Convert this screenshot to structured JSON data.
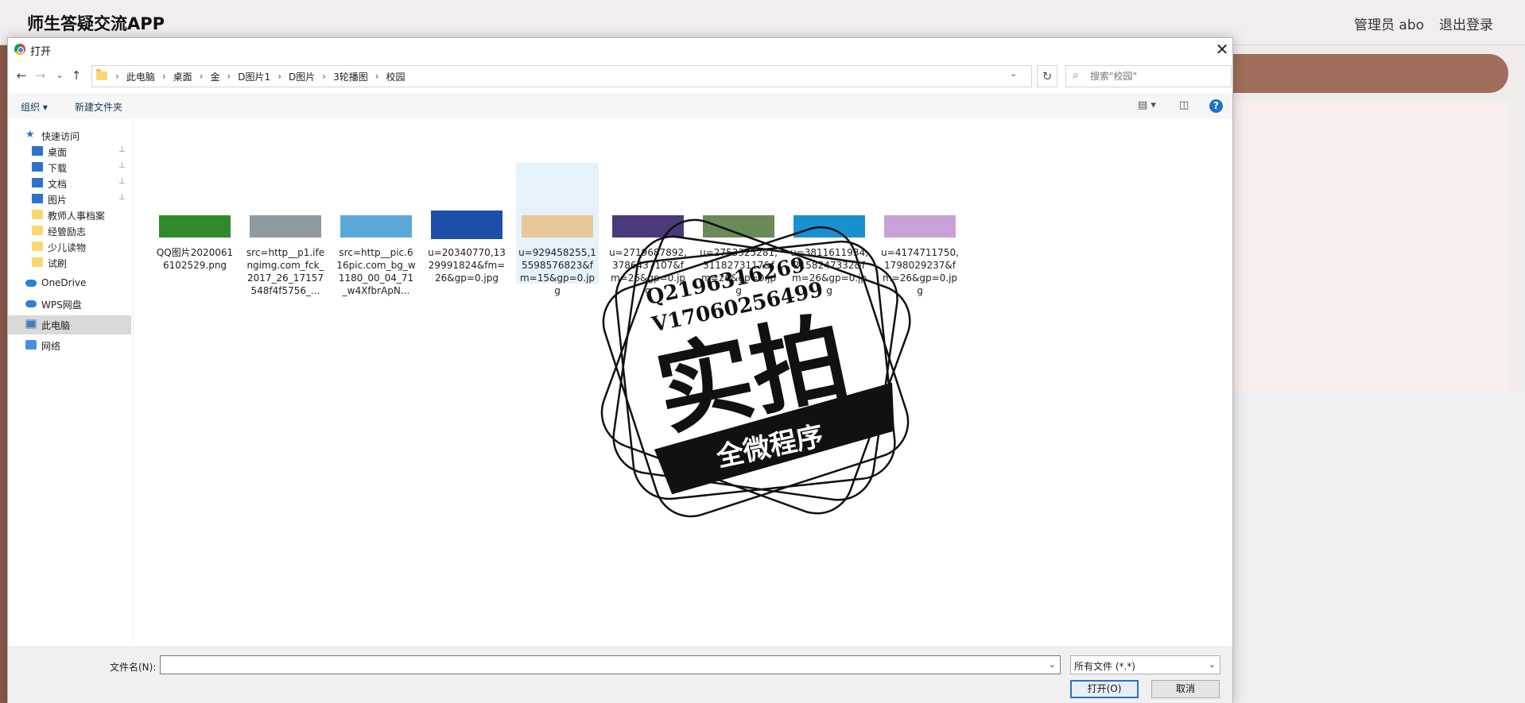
{
  "app": {
    "title": "师生答疑交流APP",
    "user": "管理员 abo",
    "logout": "退出登录"
  },
  "dialog": {
    "title": "打开",
    "close": "✕",
    "nav": {
      "back": "←",
      "forward": "→",
      "recent": "⌄",
      "up": "↑",
      "refresh": "↻",
      "dropdown": "⌄"
    },
    "breadcrumbs": [
      "此电脑",
      "桌面",
      "金",
      "D图片1",
      "D图片",
      "3轮播图",
      "校园"
    ],
    "search_placeholder": "搜索\"校园\"",
    "toolbar": {
      "organize": "组织 ▾",
      "new_folder": "新建文件夹",
      "view_icon": "▤ ▾",
      "pane_icon": "◫",
      "help": "?"
    },
    "sidebar": [
      {
        "label": "快速访问",
        "icon": "star-icon",
        "pinned": false
      },
      {
        "label": "桌面",
        "icon": "desktop-icon",
        "pinned": true
      },
      {
        "label": "下载",
        "icon": "download-icon",
        "pinned": true
      },
      {
        "label": "文档",
        "icon": "document-icon",
        "pinned": true
      },
      {
        "label": "图片",
        "icon": "picture-icon",
        "pinned": true
      },
      {
        "label": "教师人事档案",
        "icon": "folder-icon",
        "pinned": false
      },
      {
        "label": "经管励志",
        "icon": "folder-icon",
        "pinned": false
      },
      {
        "label": "少儿读物",
        "icon": "folder-icon",
        "pinned": false
      },
      {
        "label": "试刷",
        "icon": "folder-icon",
        "pinned": false
      },
      {
        "label": "OneDrive",
        "icon": "cloud-icon",
        "pinned": false
      },
      {
        "label": "WPS网盘",
        "icon": "cloud-icon",
        "pinned": false
      },
      {
        "label": "此电脑",
        "icon": "computer-icon",
        "pinned": false,
        "selected": true
      },
      {
        "label": "网络",
        "icon": "network-icon",
        "pinned": false
      }
    ],
    "pin_glyph": "📌",
    "files": [
      {
        "name": "QQ图片20200616102529.png",
        "thumb_color": "#2f8a2a"
      },
      {
        "name": "src=http__p1.ifengimg.com_fck_2017_26_17157548f4f5756_...",
        "thumb_color": "#8f9aa0"
      },
      {
        "name": "src=http__pic.616pic.com_bg_w1180_00_04_71_w4XfbrApN...",
        "thumb_color": "#5aa8d8"
      },
      {
        "name": "u=20340770,1329991824&fm=26&gp=0.jpg",
        "thumb_color": "#1e4fa8"
      },
      {
        "name": "u=929458255,15598576823&fm=15&gp=0.jpg",
        "thumb_color": "#e8c79a",
        "selected": true
      },
      {
        "name": "u=2719687892,3786437107&fm=26&gp=0.jpg",
        "thumb_color": "#4a3a7a"
      },
      {
        "name": "u=2753325281,3118273117&fm=26&gp=0.jpg",
        "thumb_color": "#6a8a5a"
      },
      {
        "name": "u=3811611934,2158247332&fm=26&gp=0.jpg",
        "thumb_color": "#1a8fd0"
      },
      {
        "name": "u=4174711750,1798029237&fm=26&gp=0.jpg",
        "thumb_color": "#c9a0d8"
      }
    ],
    "file_name_label": "文件名(N):",
    "file_name_value": "",
    "file_type": "所有文件 (*.*)",
    "open_button": "打开(O)",
    "cancel_button": "取消"
  },
  "watermark": {
    "line1": "Q2196316269",
    "line2": "V17060256499",
    "main": "实拍",
    "banner": "全微程序"
  }
}
